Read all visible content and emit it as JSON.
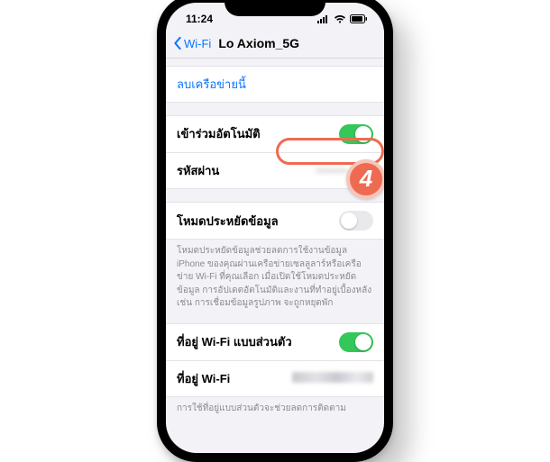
{
  "status": {
    "time": "11:24"
  },
  "nav": {
    "back_label": "Wi-Fi",
    "title": "Lo Axiom_5G"
  },
  "forget_label": "ลบเครือข่ายนี้",
  "rows": {
    "auto_join": {
      "label": "เข้าร่วมอัตโนมัติ",
      "on": true
    },
    "password": {
      "label": "รหัสผ่าน",
      "masked": "••••••••",
      "visible_suffix": "1555"
    },
    "low_data": {
      "label": "โหมดประหยัดข้อมูล",
      "on": false
    },
    "private_addr": {
      "label": "ที่อยู่ Wi-Fi แบบส่วนตัว",
      "on": true
    },
    "wifi_addr": {
      "label": "ที่อยู่ Wi-Fi"
    }
  },
  "notes": {
    "low_data": "โหมดประหยัดข้อมูลช่วยลดการใช้งานข้อมูล iPhone ของคุณผ่านเครือข่ายเซลลูลาร์หรือเครือข่าย Wi-Fi ที่คุณเลือก เมื่อเปิดใช้โหมดประหยัดข้อมูล การอัปเดตอัตโนมัติและงานที่ทำอยู่เบื้องหลัง เช่น การเชื่อมข้อมูลรูปภาพ จะถูกหยุดพัก",
    "private_addr": "การใช้ที่อยู่แบบส่วนตัวจะช่วยลดการติดตาม"
  },
  "annotation": {
    "step": "4"
  },
  "colors": {
    "accent": "#0b76ff",
    "toggle_on": "#34c759",
    "highlight": "#ee6b52"
  }
}
